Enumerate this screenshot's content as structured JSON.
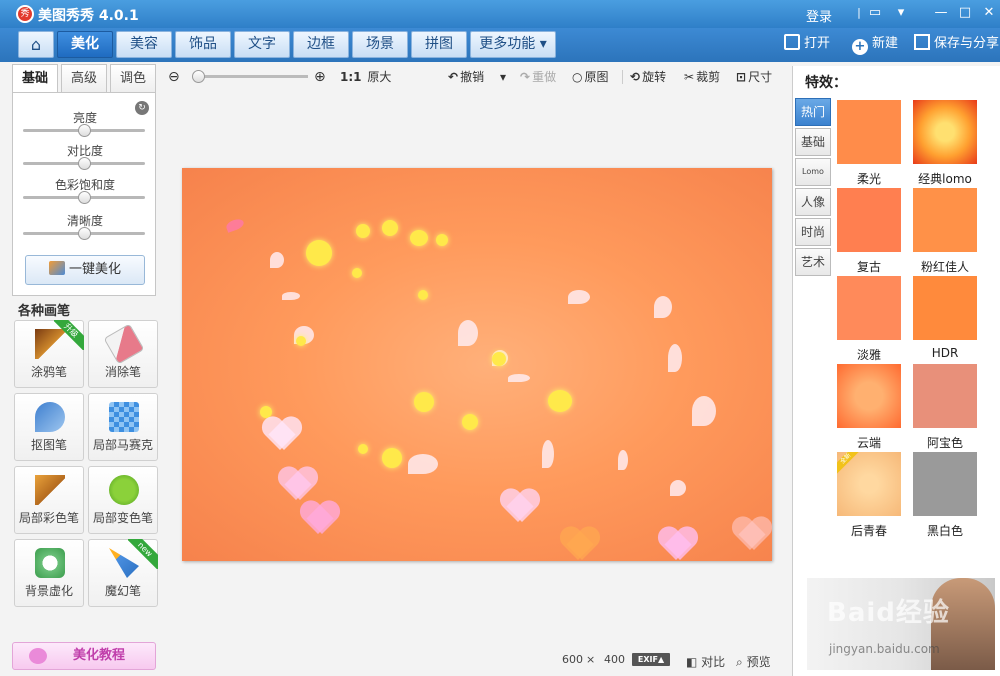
{
  "app": {
    "title": "美图秀秀 4.0.1",
    "logo": "秀",
    "login": "登录"
  },
  "nav": {
    "tabs": [
      "美化",
      "美容",
      "饰品",
      "文字",
      "边框",
      "场景",
      "拼图",
      "更多功能 ▾"
    ],
    "open": "打开",
    "new": "新建",
    "save_share": "保存与分享"
  },
  "left": {
    "subtabs": [
      "基础",
      "高级",
      "调色"
    ],
    "sliders": [
      {
        "label": "亮度",
        "level": 0.5
      },
      {
        "label": "对比度",
        "level": 0.5
      },
      {
        "label": "色彩饱和度",
        "level": 0.5
      },
      {
        "label": "清晰度",
        "level": 0.5
      }
    ],
    "one_key": "一键美化",
    "brush_title": "各种画笔",
    "brushes": [
      "涂鸦笔",
      "消除笔",
      "抠图笔",
      "局部马赛克",
      "局部彩色笔",
      "局部变色笔",
      "背景虚化",
      "魔幻笔"
    ],
    "badge_upgrade": "升级",
    "badge_new": "new",
    "tutorial": "美化教程"
  },
  "toolbar": {
    "ratio": "1:1",
    "original_size": "原大",
    "undo": "撤销",
    "redo": "重做",
    "original": "原图",
    "rotate": "旋转",
    "crop": "裁剪",
    "size": "尺寸"
  },
  "status": {
    "width": "600",
    "x": "×",
    "height": "400",
    "exif": "EXIF▲",
    "compare": "对比",
    "preview": "预览"
  },
  "effects": {
    "title": "特效：",
    "tabs": [
      "热门",
      "基础",
      "Lomo",
      "人像",
      "时尚",
      "艺术"
    ],
    "items": [
      {
        "name": "柔光",
        "color": "#ff8c4a"
      },
      {
        "name": "经典lomo",
        "color": "#ffb040"
      },
      {
        "name": "复古",
        "color": "#ff7f50"
      },
      {
        "name": "粉红佳人",
        "color": "#ff9148"
      },
      {
        "name": "淡雅",
        "color": "#ff8a5a"
      },
      {
        "name": "HDR",
        "color": "#ff8a3c"
      },
      {
        "name": "云端",
        "color": "#ff8a48"
      },
      {
        "name": "阿宝色",
        "color": "#e8907a"
      },
      {
        "name": "后青春",
        "color": "#f6b878"
      },
      {
        "name": "黑白色",
        "color": "#9a9a9a"
      }
    ],
    "badge_new": "全新"
  },
  "ad": {
    "watermark": "Baid经验",
    "watermark_url": "jingyan.baidu.com"
  }
}
